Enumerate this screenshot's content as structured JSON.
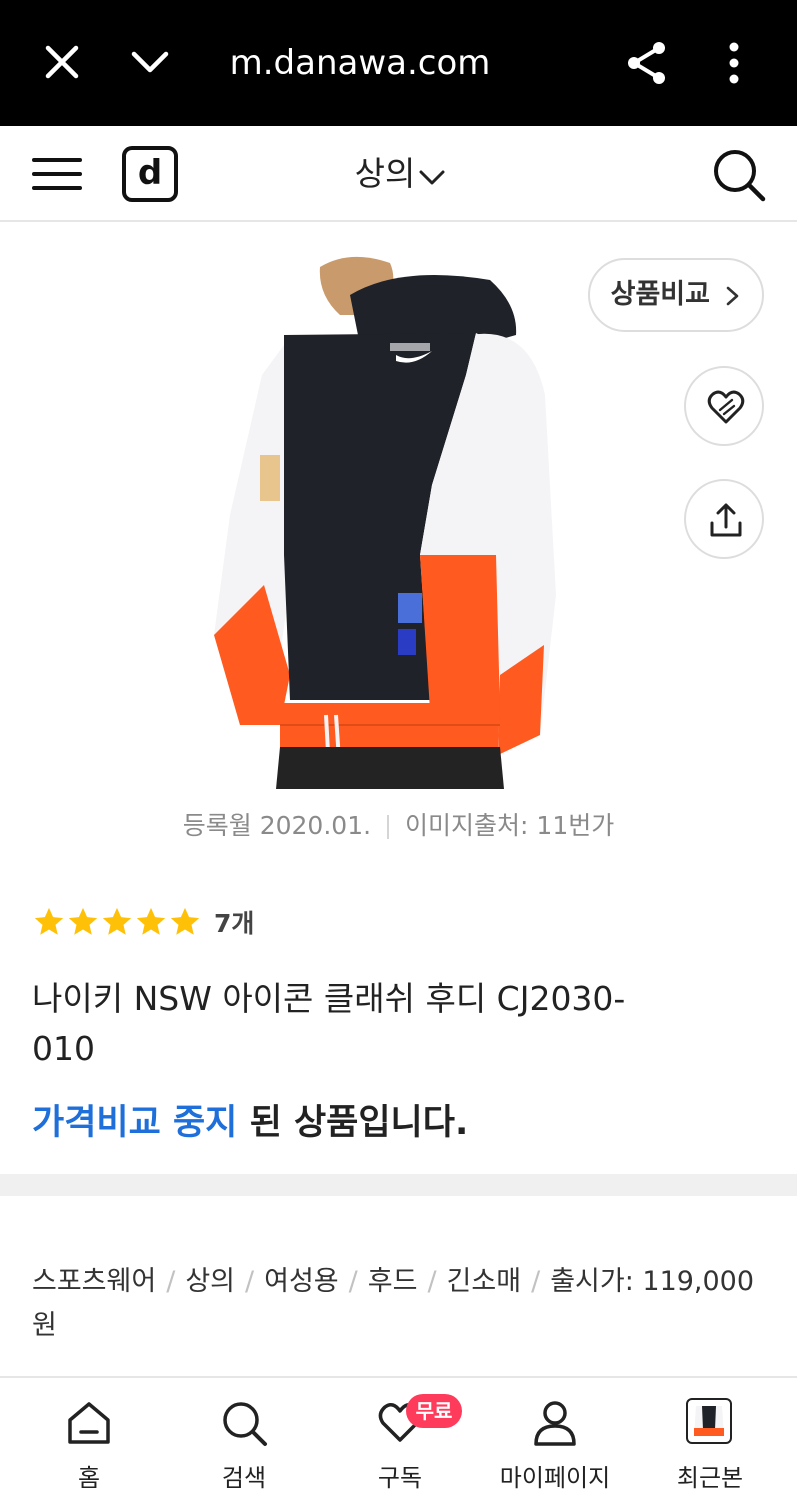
{
  "browser": {
    "url": "m.danawa.com",
    "close_icon": "close-icon",
    "collapse_icon": "chevron-down-icon",
    "share_icon": "share-icon",
    "more_icon": "more-vertical-icon"
  },
  "header": {
    "menu_icon": "menu-icon",
    "logo_text": "d",
    "category_label": "상의",
    "search_icon": "search-icon"
  },
  "product": {
    "compare_label": "상품비교",
    "register_date": "등록월 2020.01.",
    "image_source": "이미지출처: 11번가",
    "rating_stars": 5,
    "review_count": "7개",
    "title": "나이키 NSW 아이콘 클래쉬 후디 CJ2030-010",
    "status_highlight": "가격비교 중지",
    "status_rest": " 된 상품입니다."
  },
  "spec": {
    "items": [
      "스포츠웨어",
      "상의",
      "여성용",
      "후드",
      "긴소매"
    ],
    "price_label": "출시가: 119,000원"
  },
  "bottom_nav": {
    "home": "홈",
    "search": "검색",
    "subscribe": "구독",
    "free_badge": "무료",
    "mypage": "마이페이지",
    "recent": "최근본"
  },
  "colors": {
    "accent_blue": "#1e6fd9",
    "star_yellow": "#ffc107",
    "badge_pink": "#ff3b5c",
    "jacket_black": "#1f2228",
    "jacket_orange": "#ff5a1f"
  }
}
